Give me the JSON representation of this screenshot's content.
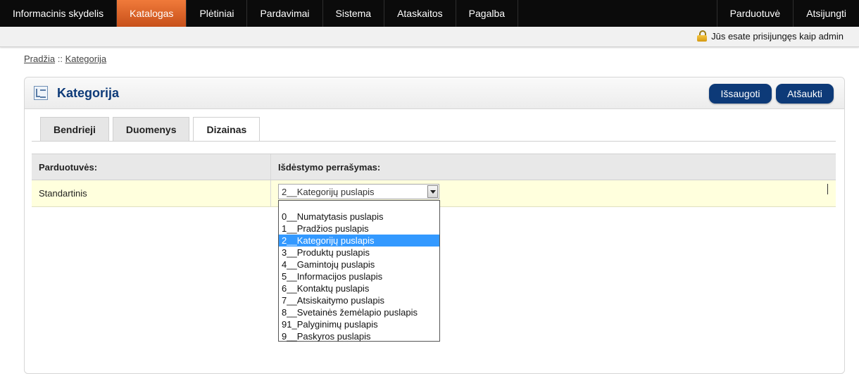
{
  "nav": {
    "items": [
      "Informacinis skydelis",
      "Katalogas",
      "Plėtiniai",
      "Pardavimai",
      "Sistema",
      "Ataskaitos",
      "Pagalba"
    ],
    "active_index": 1,
    "right_items": [
      "Parduotuvė",
      "Atsijungti"
    ]
  },
  "userbar": {
    "text": "Jūs esate prisijungęs kaip admin",
    "icon": "lock-icon"
  },
  "breadcrumb": {
    "home": "Pradžia",
    "separator": "::",
    "current": "Kategorija"
  },
  "panel": {
    "title": "Kategorija",
    "save_label": "Išsaugoti",
    "cancel_label": "Atšaukti",
    "tabs": [
      "Bendrieji",
      "Duomenys",
      "Dizainas"
    ],
    "active_tab": 2
  },
  "grid": {
    "headers": [
      "Parduotuvės:",
      "Išdėstymo perrašymas:"
    ],
    "rows": [
      {
        "store": "Standartinis"
      }
    ]
  },
  "select": {
    "value": "2__Kategorijų puslapis",
    "options": [
      "0__Numatytasis puslapis",
      "1__Pradžios puslapis",
      "2__Kategorijų puslapis",
      "3__Produktų puslapis",
      "4__Gamintojų puslapis",
      "5__Informacijos puslapis",
      "6__Kontaktų puslapis",
      "7__Atsiskaitymo puslapis",
      "8__Svetainės žemėlapio puslapis",
      "91_Palyginimų puslapis",
      "9__Paskyros puslapis"
    ],
    "selected_index": 2
  },
  "colors": {
    "nav_bg": "#0b0b0b",
    "nav_active": "#e0622a",
    "accent": "#0d3a78",
    "row_highlight": "#ffffdd",
    "option_selected": "#3399ff"
  }
}
